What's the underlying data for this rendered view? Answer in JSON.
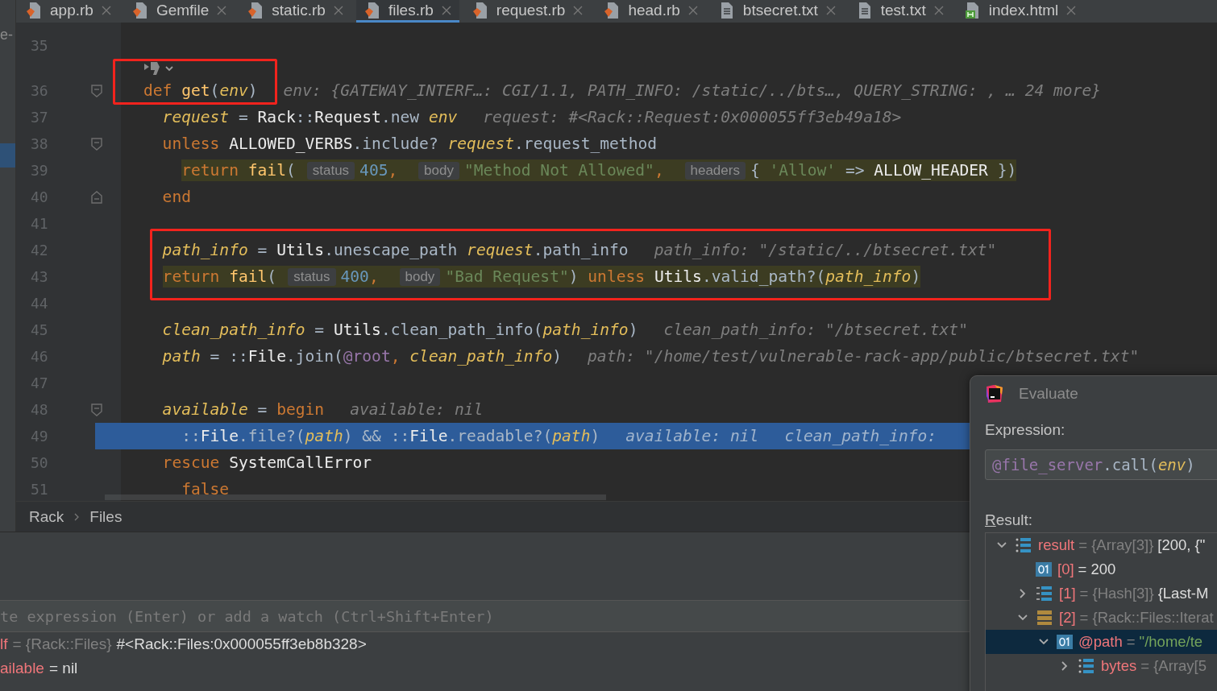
{
  "side_panel": {
    "fragment": "e-"
  },
  "tabs": [
    {
      "label": "app.rb",
      "kind": "ruby",
      "selected": false
    },
    {
      "label": "Gemfile",
      "kind": "ruby",
      "selected": false
    },
    {
      "label": "static.rb",
      "kind": "ruby",
      "selected": false
    },
    {
      "label": "files.rb",
      "kind": "ruby",
      "selected": true
    },
    {
      "label": "request.rb",
      "kind": "ruby",
      "selected": false
    },
    {
      "label": "head.rb",
      "kind": "ruby",
      "selected": false
    },
    {
      "label": "btsecret.txt",
      "kind": "text",
      "selected": false
    },
    {
      "label": "test.txt",
      "kind": "text",
      "selected": false
    },
    {
      "label": "index.html",
      "kind": "html",
      "selected": false
    }
  ],
  "editor": {
    "lines": [
      {
        "kind": "plain",
        "number": "35",
        "current": false,
        "boxed": false
      },
      {
        "kind": "inlay",
        "boxed": true
      },
      {
        "kind": "fold-start",
        "number": "36",
        "current": false,
        "highlighted": false,
        "boxed": true,
        "tokens": [
          {
            "kind": "keyword",
            "text": "def "
          },
          {
            "kind": "function",
            "text": "get"
          },
          {
            "kind": "plain",
            "text": "("
          },
          {
            "kind": "variable",
            "text": "env"
          },
          {
            "kind": "plain",
            "text": ")"
          },
          {
            "kind": "hint",
            "text": "env: {GATEWAY_INTERF…: CGI/1.1, PATH_INFO: /static/../bts…, QUERY_STRING: , … 24 more}"
          }
        ],
        "children": [
          {
            "kind": "plain",
            "number": "37",
            "current": false,
            "highlighted": false,
            "boxed": false,
            "tokens": [
              {
                "kind": "variable",
                "text": "request"
              },
              {
                "kind": "plain",
                "text": " = "
              },
              {
                "kind": "constant",
                "text": "Rack"
              },
              {
                "kind": "plain",
                "text": "::"
              },
              {
                "kind": "constant",
                "text": "Request"
              },
              {
                "kind": "plain",
                "text": ".new "
              },
              {
                "kind": "variable",
                "text": "env"
              },
              {
                "kind": "hint",
                "text": "request: #<Rack::Request:0x000055ff3eb49a18>"
              }
            ]
          },
          {
            "kind": "fold-start",
            "number": "38",
            "current": false,
            "highlighted": false,
            "boxed": false,
            "tokens": [
              {
                "kind": "keyword",
                "text": "unless "
              },
              {
                "kind": "constant",
                "text": "ALLOWED_VERBS"
              },
              {
                "kind": "plain",
                "text": ".include? "
              },
              {
                "kind": "variable",
                "text": "request"
              },
              {
                "kind": "plain",
                "text": ".request_method"
              }
            ],
            "children": [
              {
                "kind": "plain",
                "number": "39",
                "current": false,
                "highlighted": true,
                "boxed": false,
                "tokens": [
                  {
                    "kind": "keyword",
                    "text": "return "
                  },
                  {
                    "kind": "function",
                    "text": "fail"
                  },
                  {
                    "kind": "plain",
                    "text": "("
                  },
                  {
                    "kind": "param",
                    "text": "status"
                  },
                  {
                    "kind": "number",
                    "text": "405"
                  },
                  {
                    "kind": "keyword",
                    "text": ", "
                  },
                  {
                    "kind": "param",
                    "text": "body"
                  },
                  {
                    "kind": "string",
                    "text": "\"Method Not Allowed\""
                  },
                  {
                    "kind": "keyword",
                    "text": ", "
                  },
                  {
                    "kind": "param",
                    "text": "headers"
                  },
                  {
                    "kind": "plain",
                    "text": "{ "
                  },
                  {
                    "kind": "string",
                    "text": "'Allow'"
                  },
                  {
                    "kind": "plain",
                    "text": " => "
                  },
                  {
                    "kind": "constant",
                    "text": "ALLOW_HEADER"
                  },
                  {
                    "kind": "plain",
                    "text": " })"
                  }
                ]
              }
            ]
          },
          {
            "kind": "fold-end",
            "number": "40",
            "current": false,
            "highlighted": false,
            "boxed": false,
            "tokens": [
              {
                "kind": "keyword",
                "text": "end"
              }
            ]
          },
          {
            "kind": "plain",
            "number": "41",
            "current": false,
            "boxed": false
          },
          {
            "kind": "plain",
            "number": "42",
            "current": false,
            "highlighted": false,
            "boxed": true,
            "tokens": [
              {
                "kind": "variable",
                "text": "path_info"
              },
              {
                "kind": "plain",
                "text": " = "
              },
              {
                "kind": "constant",
                "text": "Utils"
              },
              {
                "kind": "plain",
                "text": ".unescape_path "
              },
              {
                "kind": "variable",
                "text": "request"
              },
              {
                "kind": "plain",
                "text": ".path_info"
              },
              {
                "kind": "hint",
                "text": "path_info: \"/static/../btsecret.txt\""
              }
            ]
          },
          {
            "kind": "plain",
            "number": "43",
            "current": false,
            "highlighted": true,
            "boxed": true,
            "tokens": [
              {
                "kind": "keyword",
                "text": "return "
              },
              {
                "kind": "function",
                "text": "fail"
              },
              {
                "kind": "plain",
                "text": "("
              },
              {
                "kind": "param",
                "text": "status"
              },
              {
                "kind": "number",
                "text": "400"
              },
              {
                "kind": "keyword",
                "text": ", "
              },
              {
                "kind": "param",
                "text": "body"
              },
              {
                "kind": "string",
                "text": "\"Bad Request\""
              },
              {
                "kind": "plain",
                "text": ") "
              },
              {
                "kind": "keyword",
                "text": "unless "
              },
              {
                "kind": "constant",
                "text": "Utils"
              },
              {
                "kind": "plain",
                "text": ".valid_path?("
              },
              {
                "kind": "variable",
                "text": "path_info"
              },
              {
                "kind": "plain",
                "text": ")"
              }
            ]
          },
          {
            "kind": "plain",
            "number": "44",
            "current": false,
            "boxed": false
          },
          {
            "kind": "plain",
            "number": "45",
            "current": false,
            "highlighted": false,
            "boxed": false,
            "tokens": [
              {
                "kind": "variable",
                "text": "clean_path_info"
              },
              {
                "kind": "plain",
                "text": " = "
              },
              {
                "kind": "constant",
                "text": "Utils"
              },
              {
                "kind": "plain",
                "text": ".clean_path_info("
              },
              {
                "kind": "variable",
                "text": "path_info"
              },
              {
                "kind": "plain",
                "text": ")"
              },
              {
                "kind": "hint",
                "text": "clean_path_info: \"/btsecret.txt\""
              }
            ]
          },
          {
            "kind": "plain",
            "number": "46",
            "current": false,
            "highlighted": false,
            "boxed": false,
            "tokens": [
              {
                "kind": "variable",
                "text": "path"
              },
              {
                "kind": "plain",
                "text": " = ::"
              },
              {
                "kind": "constant",
                "text": "File"
              },
              {
                "kind": "plain",
                "text": ".join("
              },
              {
                "kind": "ivar",
                "text": "@root"
              },
              {
                "kind": "keyword",
                "text": ", "
              },
              {
                "kind": "variable",
                "text": "clean_path_info"
              },
              {
                "kind": "plain",
                "text": ")"
              },
              {
                "kind": "hint",
                "text": "path: \"/home/test/vulnerable-rack-app/public/btsecret.txt\""
              }
            ]
          },
          {
            "kind": "plain",
            "number": "47",
            "current": false,
            "boxed": false
          },
          {
            "kind": "fold-start",
            "number": "48",
            "current": false,
            "highlighted": false,
            "boxed": false,
            "tokens": [
              {
                "kind": "variable",
                "text": "available"
              },
              {
                "kind": "plain",
                "text": " = "
              },
              {
                "kind": "keyword",
                "text": "begin"
              },
              {
                "kind": "hint",
                "text": "available: nil"
              }
            ],
            "children": [
              {
                "kind": "plain",
                "number": "49",
                "current": true,
                "highlighted": false,
                "boxed": false,
                "tokens": [
                  {
                    "kind": "plain",
                    "text": "::"
                  },
                  {
                    "kind": "constant",
                    "text": "File"
                  },
                  {
                    "kind": "plain",
                    "text": ".file?("
                  },
                  {
                    "kind": "variable",
                    "text": "path"
                  },
                  {
                    "kind": "plain",
                    "text": ") && ::"
                  },
                  {
                    "kind": "constant",
                    "text": "File"
                  },
                  {
                    "kind": "plain",
                    "text": ".readable?("
                  },
                  {
                    "kind": "variable",
                    "text": "path"
                  },
                  {
                    "kind": "plain",
                    "text": ")"
                  },
                  {
                    "kind": "hint",
                    "text": "available: nil"
                  },
                  {
                    "kind": "hint",
                    "text": "clean_path_info:"
                  }
                ]
              }
            ]
          },
          {
            "kind": "plain",
            "number": "50",
            "current": false,
            "highlighted": false,
            "boxed": false,
            "tokens": [
              {
                "kind": "keyword",
                "text": "rescue "
              },
              {
                "kind": "constant",
                "text": "SystemCallError"
              }
            ],
            "children": [
              {
                "kind": "plain",
                "number": "51",
                "current": false,
                "highlighted": false,
                "boxed": false,
                "tokens": [
                  {
                    "kind": "keyword",
                    "text": "false"
                  }
                ]
              }
            ]
          }
        ]
      }
    ]
  },
  "breadcrumb": [
    "Rack",
    "Files"
  ],
  "debugger": {
    "watch": {
      "placeholder": "te expression (Enter) or add a watch (Ctrl+Shift+Enter)"
    },
    "variables": [
      {
        "name": "lf",
        "type": "= {Rack::Files}",
        "value": "#<Rack::Files:0x000055ff3eb8b328>"
      },
      {
        "name": "ailable",
        "value": "= nil"
      }
    ]
  },
  "evaluate": {
    "title": "Evaluate",
    "expression_label": "Expression:",
    "expression": [
      {
        "kind": "ivar",
        "text": "@file_server"
      },
      {
        "kind": "plain",
        "text": ".call("
      },
      {
        "kind": "variable",
        "text": "env"
      },
      {
        "kind": "plain",
        "text": ")"
      }
    ],
    "result_label": "Result:",
    "tree": [
      {
        "name": "result",
        "type": "= {Array[3]}",
        "value": "[200, {\"",
        "kind": "array",
        "expanded": true,
        "selected": false,
        "children": [
          {
            "name": "[0]",
            "value": "= 200",
            "kind": "primitive",
            "selected": false
          },
          {
            "name": "[1]",
            "type": "= {Hash[3]}",
            "value": "{Last-M",
            "kind": "hash",
            "expanded": false,
            "selected": false
          },
          {
            "name": "[2]",
            "type": "= {Rack::Files::Iterat",
            "kind": "object",
            "expanded": true,
            "selected": false,
            "children": [
              {
                "name": "@path",
                "type": "=",
                "value": "\"/home/te",
                "kind": "string",
                "expanded": true,
                "selected": true,
                "children": [
                  {
                    "name": "bytes",
                    "type": "= {Array[5",
                    "kind": "array",
                    "expanded": false,
                    "selected": false
                  }
                ]
              }
            ]
          }
        ]
      }
    ]
  }
}
